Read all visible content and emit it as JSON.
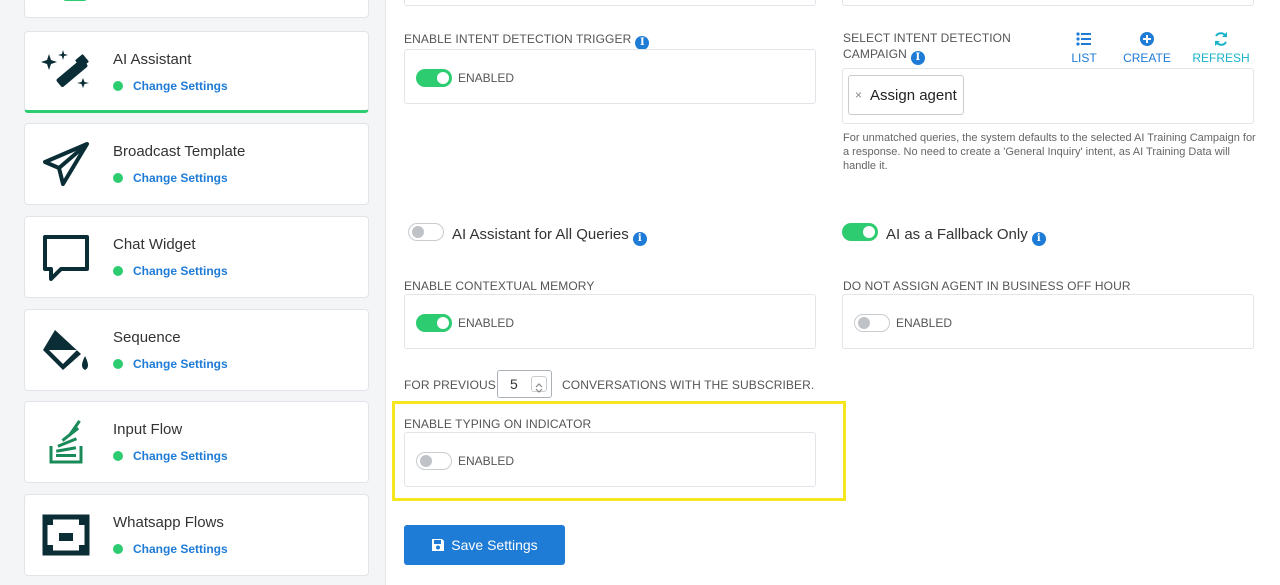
{
  "sidebar": {
    "items": [
      {
        "title": "AI Assistant",
        "sub": "Change Settings",
        "icon": "magic-wand-icon"
      },
      {
        "title": "Broadcast Template",
        "sub": "Change Settings",
        "icon": "paper-plane-icon"
      },
      {
        "title": "Chat Widget",
        "sub": "Change Settings",
        "icon": "chat-bubble-icon"
      },
      {
        "title": "Sequence",
        "sub": "Change Settings",
        "icon": "paint-bucket-icon"
      },
      {
        "title": "Input Flow",
        "sub": "Change Settings",
        "icon": "stack-icon"
      },
      {
        "title": "Whatsapp Flows",
        "sub": "Change Settings",
        "icon": "flow-icon"
      }
    ]
  },
  "main": {
    "intent_trigger": {
      "label": "ENABLE INTENT DETECTION TRIGGER",
      "toggle_label": "ENABLED",
      "on": true
    },
    "intent_campaign": {
      "label_line1": "SELECT INTENT DETECTION",
      "label_line2": "CAMPAIGN",
      "selected_tag": "Assign agent",
      "tag_remove": "×",
      "actions": {
        "list": "LIST",
        "create": "CREATE",
        "refresh": "REFRESH"
      },
      "hint": "For unmatched queries, the system defaults to the selected AI Training Campaign for a response. No need to create a 'General Inquiry' intent, as AI Training Data will handle it."
    },
    "ai_all_queries": {
      "label": "AI Assistant for All Queries",
      "on": false
    },
    "ai_fallback": {
      "label": "AI as a Fallback Only",
      "on": true
    },
    "contextual_memory": {
      "label": "ENABLE CONTEXTUAL MEMORY",
      "toggle_label": "ENABLED",
      "on": true
    },
    "off_hour": {
      "label": "DO NOT ASSIGN AGENT IN BUSINESS OFF HOUR",
      "toggle_label": "ENABLED",
      "on": false
    },
    "previous": {
      "prefix": "FOR PREVIOUS",
      "value": "5",
      "suffix": "CONVERSATIONS WITH THE SUBSCRIBER."
    },
    "typing": {
      "label": "ENABLE TYPING ON INDICATOR",
      "toggle_label": "ENABLED",
      "on": false
    },
    "save_label": "Save Settings"
  },
  "colors": {
    "accent": "#1e7bd6",
    "success": "#2ecc71",
    "highlight": "#f5e61f"
  }
}
